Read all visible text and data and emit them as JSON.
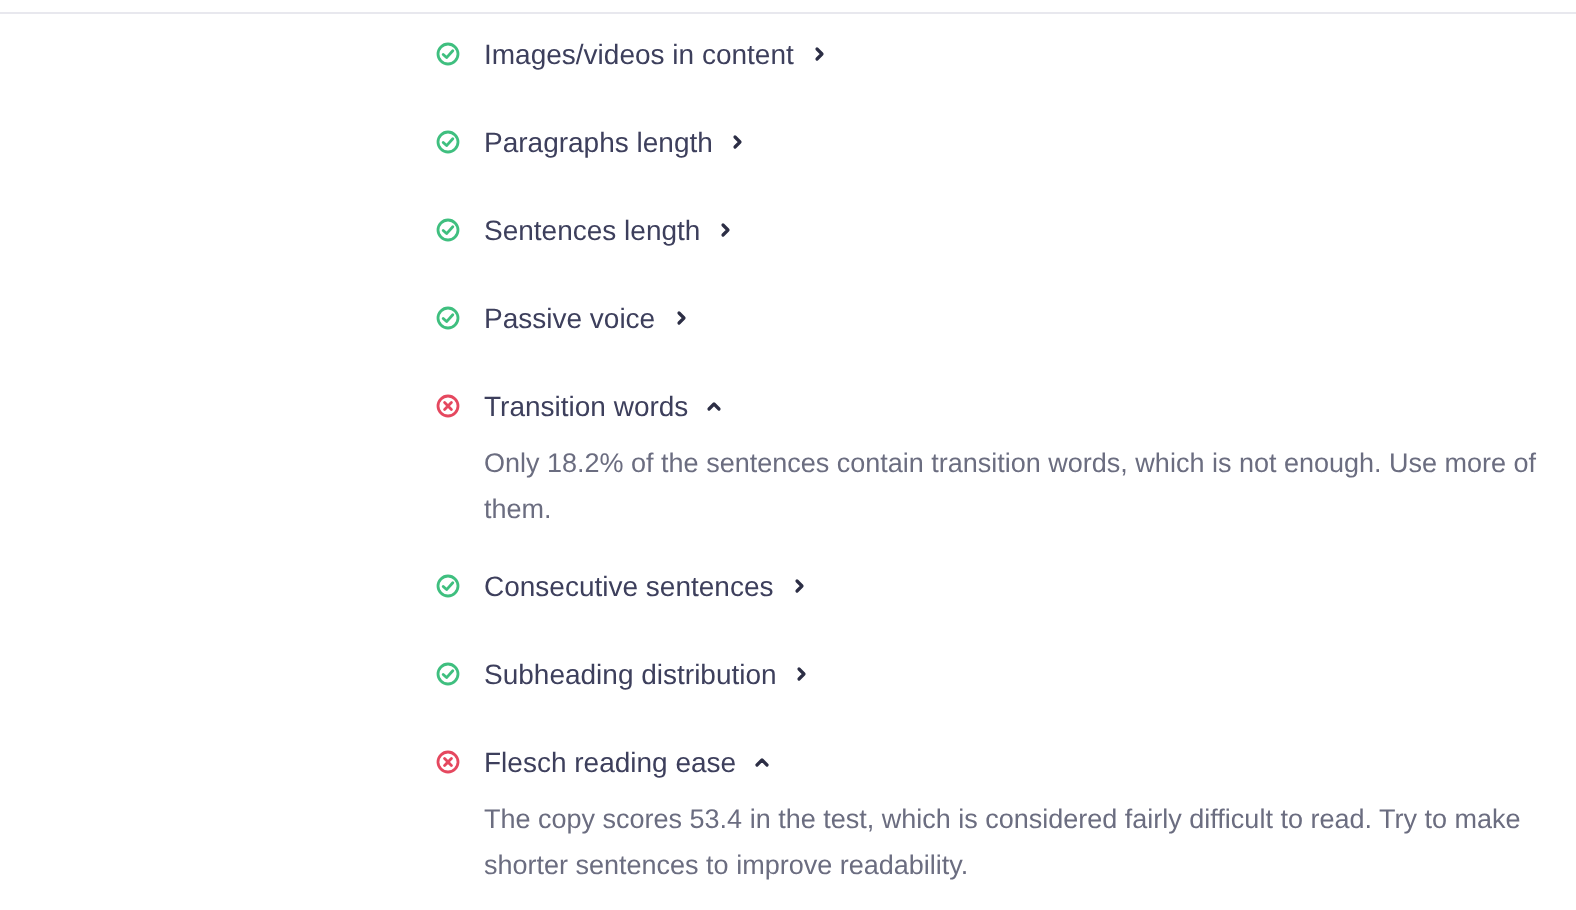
{
  "checks": [
    {
      "title": "Images/videos in content",
      "kind": "pass",
      "expanded": false
    },
    {
      "title": "Paragraphs length",
      "kind": "pass",
      "expanded": false
    },
    {
      "title": "Sentences length",
      "kind": "pass",
      "expanded": false
    },
    {
      "title": "Passive voice",
      "kind": "pass",
      "expanded": false
    },
    {
      "title": "Transition words",
      "kind": "fail",
      "expanded": true,
      "description": "Only 18.2% of the sentences contain transition words, which is not enough. Use more of them."
    },
    {
      "title": "Consecutive sentences",
      "kind": "pass",
      "expanded": false
    },
    {
      "title": "Subheading distribution",
      "kind": "pass",
      "expanded": false
    },
    {
      "title": "Flesch reading ease",
      "kind": "fail",
      "expanded": true,
      "description": "The copy scores 53.4 in the test, which is considered fairly difficult to read. Try to make shorter sentences to improve readability."
    }
  ]
}
